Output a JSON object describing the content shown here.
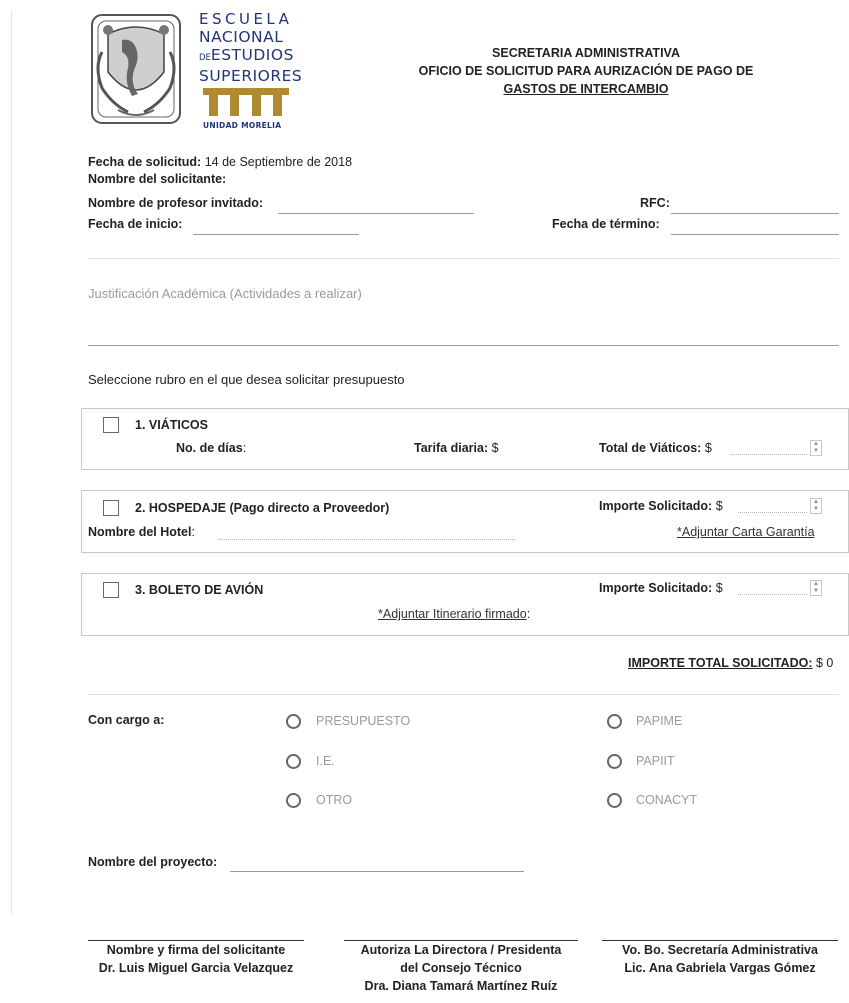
{
  "logo": {
    "line1": "ESCUELA",
    "line2": "NACIONAL",
    "line3_prefix": "DE",
    "line3": "ESTUDIOS",
    "line4": "SUPERIORES",
    "unit": "UNIDAD MORELIA"
  },
  "header": {
    "title1": "SECRETARIA ADMINISTRATIVA",
    "title2": "OFICIO DE SOLICITUD PARA AURIZACIÓN DE PAGO DE",
    "title3": "GASTOS DE INTERCAMBIO"
  },
  "request": {
    "date_label": "Fecha de solicitud:",
    "date_value": "14 de Septiembre de 2018",
    "applicant_label": "Nombre del solicitante:",
    "guest_label": "Nombre de profesor invitado:",
    "rfc_label": "RFC:",
    "start_label": "Fecha de inicio:",
    "end_label": "Fecha de término:"
  },
  "justification": {
    "placeholder": "Justificación Académica (Actividades a realizar)"
  },
  "select_prompt": "Seleccione rubro en el que desea solicitar presupuesto",
  "viaticos": {
    "title": "1. VIÁTICOS",
    "days_label": "No. de días",
    "days_colon": ":",
    "rate_label": "Tarifa diaria:",
    "rate_currency": "$",
    "total_label": "Total de Viáticos:",
    "total_currency": "$"
  },
  "hospedaje": {
    "title": "2. HOSPEDAJE (Pago directo a Proveedor)",
    "amount_label": "Importe Solicitado:",
    "amount_currency": "$",
    "hotel_label": "Nombre del Hotel",
    "hotel_colon": ":",
    "attach_link": "*Adjuntar Carta Garantía"
  },
  "avion": {
    "title": "3. BOLETO DE AVIÓN",
    "amount_label": "Importe Solicitado:",
    "amount_currency": "$",
    "attach_link": "*Adjuntar Itinerario firmado",
    "attach_colon": ":"
  },
  "total": {
    "label": "IMPORTE TOTAL SOLICITADO:",
    "value": "$ 0"
  },
  "charge": {
    "label": "Con cargo a:",
    "options_left": [
      "PRESUPUESTO",
      "I.E.",
      "OTRO"
    ],
    "options_right": [
      "PAPIME",
      "PAPIIT",
      "CONACYT"
    ]
  },
  "project": {
    "label": "Nombre del proyecto:"
  },
  "signatures": [
    {
      "role": "Nombre y firma del solicitante",
      "name": "Dr. Luis Miguel Garcia Velazquez"
    },
    {
      "role": "Autoriza La Directora / Presidenta",
      "role2": "del Consejo Técnico",
      "name": "Dra. Diana Tamará Martínez Ruíz"
    },
    {
      "role": "Vo. Bo. Secretaría Administrativa",
      "name": "Lic. Ana Gabriela Vargas Gómez"
    }
  ],
  "icons": {
    "crest": "unam-crest-icon",
    "columns": "columns-logo-icon",
    "spinner": "spinner-arrows-icon"
  },
  "colors": {
    "logo_blue": "#20357a",
    "logo_gold": "#b08a2e",
    "muted_text": "#9a9a9a",
    "border": "#c9c9c9"
  }
}
